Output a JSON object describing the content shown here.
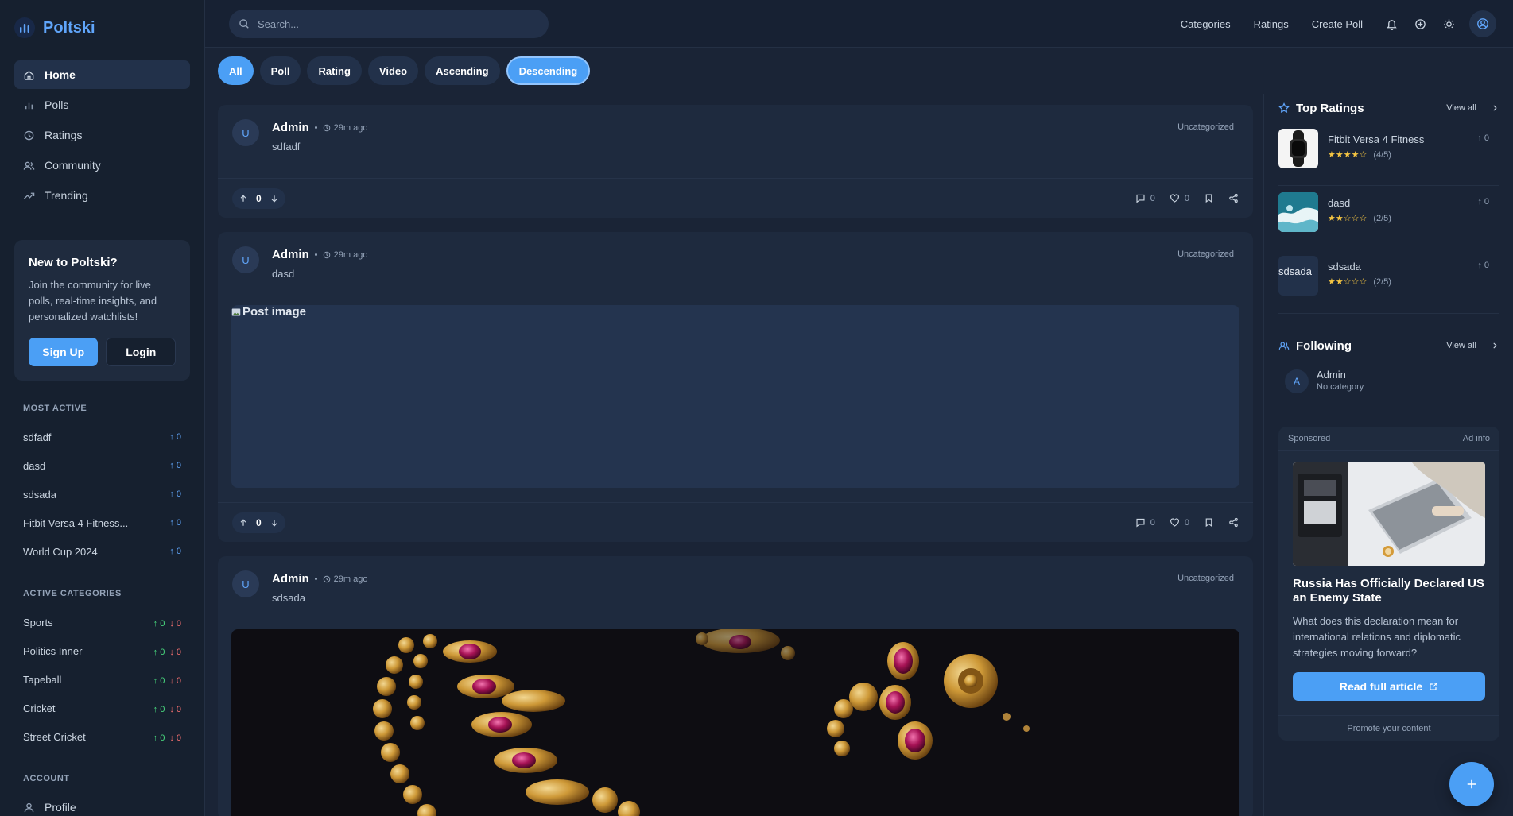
{
  "app": {
    "name": "Poltski"
  },
  "sidebar": {
    "nav": [
      {
        "label": "Home",
        "icon": "home-icon",
        "active": true
      },
      {
        "label": "Polls",
        "icon": "bar-chart-icon"
      },
      {
        "label": "Ratings",
        "icon": "clock-icon"
      },
      {
        "label": "Community",
        "icon": "users-icon"
      },
      {
        "label": "Trending",
        "icon": "trending-up-icon"
      }
    ],
    "join": {
      "title": "New to Poltski?",
      "text": "Join the community for live polls, real-time insights, and personalized watchlists!",
      "signup": "Sign Up",
      "login": "Login"
    },
    "most_active_title": "MOST ACTIVE",
    "most_active": [
      {
        "label": "sdfadf",
        "count": "0"
      },
      {
        "label": "dasd",
        "count": "0"
      },
      {
        "label": "sdsada",
        "count": "0"
      },
      {
        "label": "Fitbit Versa 4 Fitness...",
        "count": "0"
      },
      {
        "label": "World Cup 2024",
        "count": "0"
      }
    ],
    "categories_title": "ACTIVE CATEGORIES",
    "categories": [
      {
        "label": "Sports",
        "up": "0",
        "down": "0"
      },
      {
        "label": "Politics Inner",
        "up": "0",
        "down": "0"
      },
      {
        "label": "Tapeball",
        "up": "0",
        "down": "0"
      },
      {
        "label": "Cricket",
        "up": "0",
        "down": "0"
      },
      {
        "label": "Street Cricket",
        "up": "0",
        "down": "0"
      }
    ],
    "account_title": "ACCOUNT",
    "account": [
      {
        "label": "Profile"
      }
    ]
  },
  "topbar": {
    "search_placeholder": "Search...",
    "links": [
      "Categories",
      "Ratings",
      "Create Poll"
    ]
  },
  "filters": [
    "All",
    "Poll",
    "Rating",
    "Video",
    "Ascending",
    "Descending"
  ],
  "posts": [
    {
      "author": "Admin",
      "avatar": "U",
      "time": "29m ago",
      "text": "sdfadf",
      "category": "Uncategorized",
      "votes": "0",
      "comments": "0",
      "likes": "0"
    },
    {
      "author": "Admin",
      "avatar": "U",
      "time": "29m ago",
      "text": "dasd",
      "category": "Uncategorized",
      "image_alt": "Post image",
      "votes": "0",
      "comments": "0",
      "likes": "0"
    },
    {
      "author": "Admin",
      "avatar": "U",
      "time": "29m ago",
      "text": "sdsada",
      "category": "Uncategorized"
    }
  ],
  "top_ratings": {
    "title": "Top Ratings",
    "view_all": "View all",
    "items": [
      {
        "name": "Fitbit Versa 4 Fitness",
        "stars": 4,
        "score": "(4/5)",
        "up": "0"
      },
      {
        "name": "dasd",
        "stars": 2,
        "score": "(2/5)",
        "up": "0"
      },
      {
        "name": "sdsada",
        "stars": 2,
        "score": "(2/5)",
        "up": "0",
        "alt": "sdsada"
      }
    ]
  },
  "following": {
    "title": "Following",
    "view_all": "View all",
    "items": [
      {
        "name": "Admin",
        "sub": "No category",
        "avatar": "A"
      }
    ]
  },
  "ad": {
    "sponsored": "Sponsored",
    "info": "Ad info",
    "title": "Russia Has Officially Declared US an Enemy State",
    "text": "What does this declaration mean for international relations and diplomatic strategies moving forward?",
    "cta": "Read full article",
    "footer": "Promote your content"
  },
  "colors": {
    "accent": "#4b9ff5",
    "bg": "#1a2436",
    "sidebar": "#16202f",
    "card": "#1e2a3e"
  }
}
